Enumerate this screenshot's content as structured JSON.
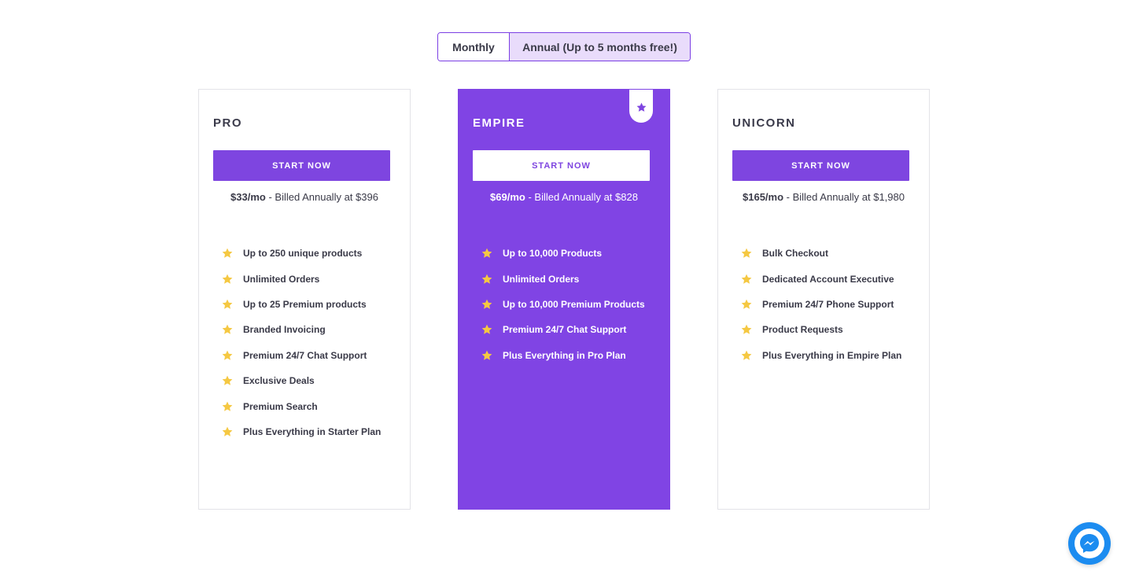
{
  "billing_toggle": {
    "monthly_label": "Monthly",
    "annual_label": "Annual (Up to 5 months free!)",
    "selected": "annual"
  },
  "plans": [
    {
      "name": "PRO",
      "cta": "START NOW",
      "price": "$33/mo",
      "billing": " - Billed Annually at $396",
      "features": [
        "Up to 250 unique products",
        "Unlimited Orders",
        "Up to 25 Premium products",
        "Branded Invoicing",
        "Premium 24/7 Chat Support",
        "Exclusive Deals",
        "Premium Search",
        "Plus Everything in Starter Plan"
      ]
    },
    {
      "name": "EMPIRE",
      "cta": "START NOW",
      "price": "$69/mo",
      "billing": " - Billed Annually at $828",
      "featured": true,
      "features": [
        "Up to 10,000 Products",
        "Unlimited Orders",
        "Up to 10,000 Premium Products",
        "Premium 24/7 Chat Support",
        "Plus Everything in Pro Plan"
      ]
    },
    {
      "name": "UNICORN",
      "cta": "START NOW",
      "price": "$165/mo",
      "billing": " - Billed Annually at $1,980",
      "features": [
        "Bulk Checkout",
        "Dedicated Account Executive",
        "Premium 24/7 Phone Support",
        "Product Requests",
        "Plus Everything in Empire Plan"
      ]
    }
  ],
  "icons": {
    "feature_bullet": "star-icon",
    "featured_badge": "star-icon",
    "chat_widget": "messenger-icon"
  },
  "colors": {
    "accent": "#7e45e0",
    "featured_card": "#8044e4",
    "star": "#f5c842",
    "toggle_selected_bg": "#e9dcfb",
    "messenger": "#1c8cf0"
  }
}
